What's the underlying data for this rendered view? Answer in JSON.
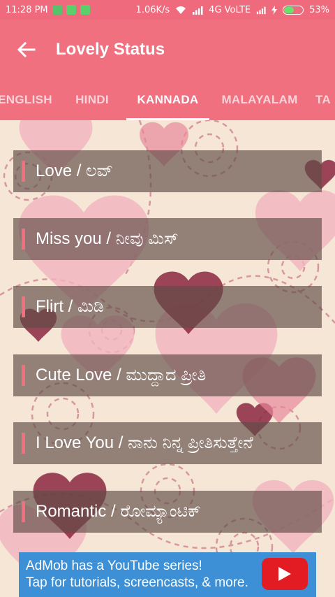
{
  "status_bar": {
    "time": "11:28 PM",
    "network_speed": "1.06K/s",
    "network_type": "4G VoLTE",
    "battery": "53%",
    "battery_level": 0.53
  },
  "app_bar": {
    "title": "Lovely Status",
    "back_icon": "arrow-left-icon"
  },
  "tabs": [
    {
      "label": "ENGLISH",
      "active": false
    },
    {
      "label": "HINDI",
      "active": false
    },
    {
      "label": "KANNADA",
      "active": true
    },
    {
      "label": "MALAYALAM",
      "active": false
    },
    {
      "label": "TA",
      "active": false
    }
  ],
  "list": [
    {
      "label": "Love / ಲವ್"
    },
    {
      "label": "Miss you / ನೀವು ಮಿಸ್"
    },
    {
      "label": "Flirt / ಮಿಡಿ"
    },
    {
      "label": "Cute Love / ಮುದ್ದಾದ ಪ್ರೀತಿ"
    },
    {
      "label": "I Love You / ನಾನು ನಿನ್ನ ಪ್ರೀತಿಸುತ್ತೇನೆ"
    },
    {
      "label": "Romantic / ರೋಮ್ಯಾಂಟಿಕ್"
    }
  ],
  "ad": {
    "line1": "AdMob has a YouTube series!",
    "line2": "Tap for tutorials, screencasts, & more.",
    "icon": "youtube-play-icon"
  },
  "colors": {
    "accent": "#f07080",
    "row_background": "#604c48",
    "ad_background": "#3d8fd6"
  }
}
